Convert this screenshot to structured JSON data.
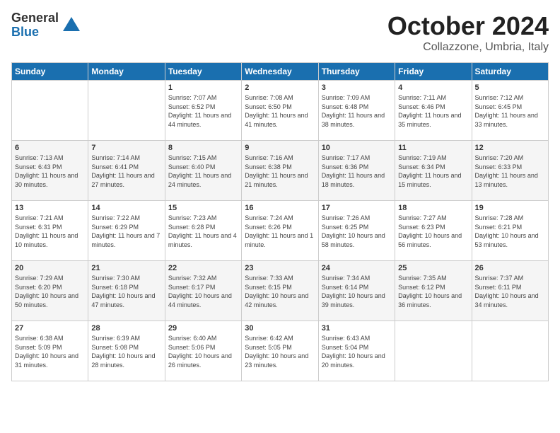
{
  "logo": {
    "general": "General",
    "blue": "Blue"
  },
  "title": "October 2024",
  "subtitle": "Collazzone, Umbria, Italy",
  "headers": [
    "Sunday",
    "Monday",
    "Tuesday",
    "Wednesday",
    "Thursday",
    "Friday",
    "Saturday"
  ],
  "weeks": [
    [
      {
        "day": "",
        "info": ""
      },
      {
        "day": "",
        "info": ""
      },
      {
        "day": "1",
        "info": "Sunrise: 7:07 AM\nSunset: 6:52 PM\nDaylight: 11 hours and 44 minutes."
      },
      {
        "day": "2",
        "info": "Sunrise: 7:08 AM\nSunset: 6:50 PM\nDaylight: 11 hours and 41 minutes."
      },
      {
        "day": "3",
        "info": "Sunrise: 7:09 AM\nSunset: 6:48 PM\nDaylight: 11 hours and 38 minutes."
      },
      {
        "day": "4",
        "info": "Sunrise: 7:11 AM\nSunset: 6:46 PM\nDaylight: 11 hours and 35 minutes."
      },
      {
        "day": "5",
        "info": "Sunrise: 7:12 AM\nSunset: 6:45 PM\nDaylight: 11 hours and 33 minutes."
      }
    ],
    [
      {
        "day": "6",
        "info": "Sunrise: 7:13 AM\nSunset: 6:43 PM\nDaylight: 11 hours and 30 minutes."
      },
      {
        "day": "7",
        "info": "Sunrise: 7:14 AM\nSunset: 6:41 PM\nDaylight: 11 hours and 27 minutes."
      },
      {
        "day": "8",
        "info": "Sunrise: 7:15 AM\nSunset: 6:40 PM\nDaylight: 11 hours and 24 minutes."
      },
      {
        "day": "9",
        "info": "Sunrise: 7:16 AM\nSunset: 6:38 PM\nDaylight: 11 hours and 21 minutes."
      },
      {
        "day": "10",
        "info": "Sunrise: 7:17 AM\nSunset: 6:36 PM\nDaylight: 11 hours and 18 minutes."
      },
      {
        "day": "11",
        "info": "Sunrise: 7:19 AM\nSunset: 6:34 PM\nDaylight: 11 hours and 15 minutes."
      },
      {
        "day": "12",
        "info": "Sunrise: 7:20 AM\nSunset: 6:33 PM\nDaylight: 11 hours and 13 minutes."
      }
    ],
    [
      {
        "day": "13",
        "info": "Sunrise: 7:21 AM\nSunset: 6:31 PM\nDaylight: 11 hours and 10 minutes."
      },
      {
        "day": "14",
        "info": "Sunrise: 7:22 AM\nSunset: 6:29 PM\nDaylight: 11 hours and 7 minutes."
      },
      {
        "day": "15",
        "info": "Sunrise: 7:23 AM\nSunset: 6:28 PM\nDaylight: 11 hours and 4 minutes."
      },
      {
        "day": "16",
        "info": "Sunrise: 7:24 AM\nSunset: 6:26 PM\nDaylight: 11 hours and 1 minute."
      },
      {
        "day": "17",
        "info": "Sunrise: 7:26 AM\nSunset: 6:25 PM\nDaylight: 10 hours and 58 minutes."
      },
      {
        "day": "18",
        "info": "Sunrise: 7:27 AM\nSunset: 6:23 PM\nDaylight: 10 hours and 56 minutes."
      },
      {
        "day": "19",
        "info": "Sunrise: 7:28 AM\nSunset: 6:21 PM\nDaylight: 10 hours and 53 minutes."
      }
    ],
    [
      {
        "day": "20",
        "info": "Sunrise: 7:29 AM\nSunset: 6:20 PM\nDaylight: 10 hours and 50 minutes."
      },
      {
        "day": "21",
        "info": "Sunrise: 7:30 AM\nSunset: 6:18 PM\nDaylight: 10 hours and 47 minutes."
      },
      {
        "day": "22",
        "info": "Sunrise: 7:32 AM\nSunset: 6:17 PM\nDaylight: 10 hours and 44 minutes."
      },
      {
        "day": "23",
        "info": "Sunrise: 7:33 AM\nSunset: 6:15 PM\nDaylight: 10 hours and 42 minutes."
      },
      {
        "day": "24",
        "info": "Sunrise: 7:34 AM\nSunset: 6:14 PM\nDaylight: 10 hours and 39 minutes."
      },
      {
        "day": "25",
        "info": "Sunrise: 7:35 AM\nSunset: 6:12 PM\nDaylight: 10 hours and 36 minutes."
      },
      {
        "day": "26",
        "info": "Sunrise: 7:37 AM\nSunset: 6:11 PM\nDaylight: 10 hours and 34 minutes."
      }
    ],
    [
      {
        "day": "27",
        "info": "Sunrise: 6:38 AM\nSunset: 5:09 PM\nDaylight: 10 hours and 31 minutes."
      },
      {
        "day": "28",
        "info": "Sunrise: 6:39 AM\nSunset: 5:08 PM\nDaylight: 10 hours and 28 minutes."
      },
      {
        "day": "29",
        "info": "Sunrise: 6:40 AM\nSunset: 5:06 PM\nDaylight: 10 hours and 26 minutes."
      },
      {
        "day": "30",
        "info": "Sunrise: 6:42 AM\nSunset: 5:05 PM\nDaylight: 10 hours and 23 minutes."
      },
      {
        "day": "31",
        "info": "Sunrise: 6:43 AM\nSunset: 5:04 PM\nDaylight: 10 hours and 20 minutes."
      },
      {
        "day": "",
        "info": ""
      },
      {
        "day": "",
        "info": ""
      }
    ]
  ]
}
